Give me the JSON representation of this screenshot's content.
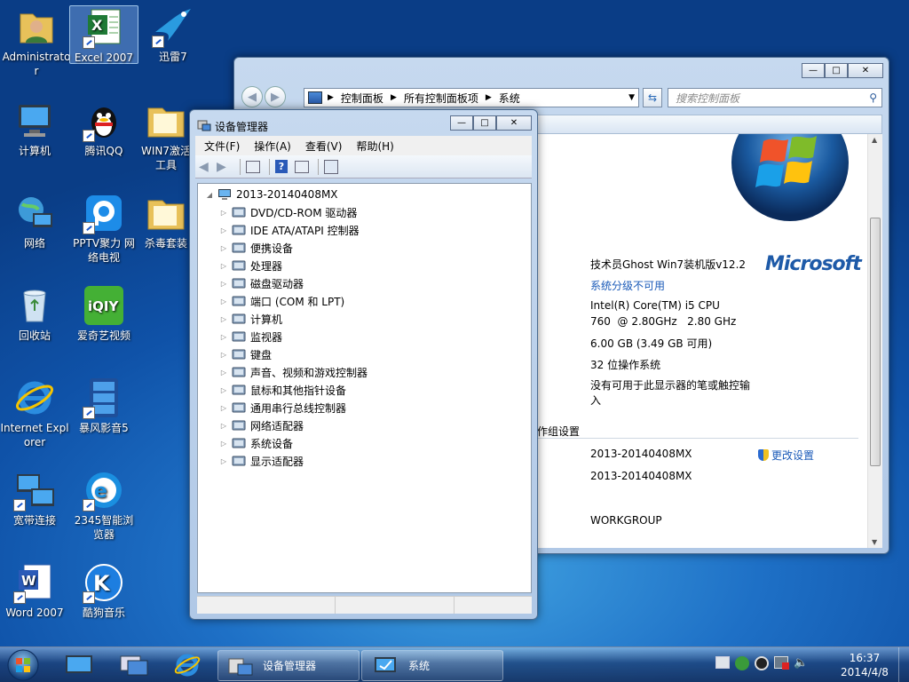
{
  "desktop": {
    "icons": [
      {
        "label": "Administrator",
        "icon": "user-folder-icon"
      },
      {
        "label": "Excel 2007",
        "icon": "excel-icon"
      },
      {
        "label": "迅雷7",
        "icon": "xunlei-icon"
      },
      {
        "label": "计算机",
        "icon": "computer-icon"
      },
      {
        "label": "腾讯QQ",
        "icon": "qq-icon"
      },
      {
        "label": "WIN7激活工具",
        "icon": "folder-icon"
      },
      {
        "label": "网络",
        "icon": "network-icon"
      },
      {
        "label": "PPTV聚力 网络电视",
        "icon": "pptv-icon"
      },
      {
        "label": "杀毒套装",
        "icon": "folder-icon"
      },
      {
        "label": "回收站",
        "icon": "recycle-bin-icon"
      },
      {
        "label": "爱奇艺视频",
        "icon": "iqiyi-icon"
      },
      {
        "label": "Internet Explorer",
        "icon": "ie-icon"
      },
      {
        "label": "暴风影音5",
        "icon": "baofeng-icon"
      },
      {
        "label": "宽带连接",
        "icon": "broadband-icon"
      },
      {
        "label": "2345智能浏览器",
        "icon": "browser-2345-icon"
      },
      {
        "label": "Word 2007",
        "icon": "word-icon"
      },
      {
        "label": "酷狗音乐",
        "icon": "kugou-icon"
      }
    ]
  },
  "system_window": {
    "breadcrumb": [
      "控制面板",
      "所有控制面板项",
      "系统"
    ],
    "search_placeholder": "搜索控制面板",
    "edition": "技术员Ghost Win7装机版v12.2",
    "rating_link": "系统分级不可用",
    "cpu_line1": "Intel(R) Core(TM) i5 CPU",
    "cpu_line2": "760  @ 2.80GHz   2.80 GHz",
    "ram": "6.00 GB (3.49 GB 可用)",
    "system_type": "32 位操作系统",
    "pen_touch": "没有可用于此显示器的笔或触控输入",
    "section_workgroup": "作组设置",
    "computer_name": "2013-20140408MX",
    "full_name": "2013-20140408MX",
    "workgroup": "WORKGROUP",
    "change_settings": "更改设置",
    "microsoft_logo": "Microsoft"
  },
  "device_manager": {
    "title": "设备管理器",
    "menu": [
      "文件(F)",
      "操作(A)",
      "查看(V)",
      "帮助(H)"
    ],
    "root": "2013-20140408MX",
    "devices": [
      {
        "label": "DVD/CD-ROM 驱动器",
        "icon": "dvd-drive-icon"
      },
      {
        "label": "IDE ATA/ATAPI 控制器",
        "icon": "ide-controller-icon"
      },
      {
        "label": "便携设备",
        "icon": "portable-device-icon"
      },
      {
        "label": "处理器",
        "icon": "processor-icon"
      },
      {
        "label": "磁盘驱动器",
        "icon": "disk-drive-icon"
      },
      {
        "label": "端口 (COM 和 LPT)",
        "icon": "port-icon"
      },
      {
        "label": "计算机",
        "icon": "computer-icon"
      },
      {
        "label": "监视器",
        "icon": "monitor-icon"
      },
      {
        "label": "键盘",
        "icon": "keyboard-icon"
      },
      {
        "label": "声音、视频和游戏控制器",
        "icon": "sound-icon"
      },
      {
        "label": "鼠标和其他指针设备",
        "icon": "mouse-icon"
      },
      {
        "label": "通用串行总线控制器",
        "icon": "usb-icon"
      },
      {
        "label": "网络适配器",
        "icon": "network-adapter-icon"
      },
      {
        "label": "系统设备",
        "icon": "system-device-icon"
      },
      {
        "label": "显示适配器",
        "icon": "display-adapter-icon"
      }
    ]
  },
  "taskbar": {
    "tasks": [
      {
        "label": "设备管理器"
      },
      {
        "label": "系统"
      }
    ],
    "time": "16:37",
    "date": "2014/4/8"
  }
}
